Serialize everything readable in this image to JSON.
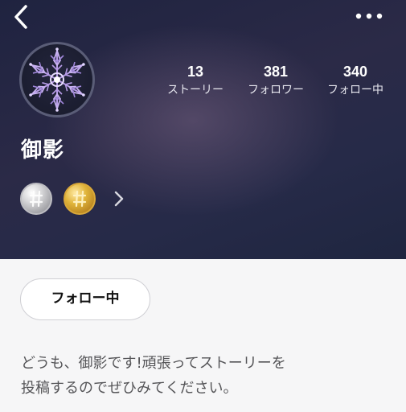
{
  "header": {
    "back_icon": "chevron-left-icon",
    "more_icon": "more-horizontal-icon"
  },
  "profile": {
    "avatar_icon": "snowflake-icon",
    "name": "御影",
    "stats": [
      {
        "value": "13",
        "label": "ストーリー"
      },
      {
        "value": "381",
        "label": "フォロワー"
      },
      {
        "value": "340",
        "label": "フォロー中"
      }
    ],
    "badges": [
      {
        "icon": "silver-badge-icon",
        "color": "#b8b8bd"
      },
      {
        "icon": "gold-badge-icon",
        "color": "#d9a83a"
      }
    ],
    "follow_button_label": "フォロー中",
    "bio_lines": [
      "どうも、御影です!頑張ってストーリーを",
      "投稿するのでぜひみてください。"
    ]
  },
  "colors": {
    "header_bg": "#272a46",
    "page_bg": "#f6f6f7",
    "text_primary": "#ffffff",
    "bio_text": "#555558"
  }
}
